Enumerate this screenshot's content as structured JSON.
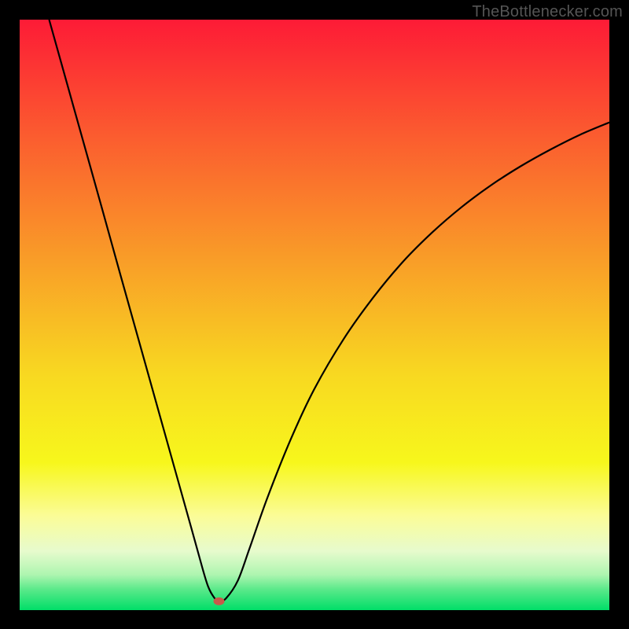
{
  "source_label": "TheBottlenecker.com",
  "chart_data": {
    "type": "line",
    "title": "",
    "xlabel": "",
    "ylabel": "",
    "xlim": [
      0,
      100
    ],
    "ylim": [
      0,
      100
    ],
    "grid": false,
    "background": {
      "type": "vertical-gradient",
      "stops": [
        {
          "offset": 0.0,
          "color": "#fd1b36"
        },
        {
          "offset": 0.2,
          "color": "#fb5d2f"
        },
        {
          "offset": 0.4,
          "color": "#f99b28"
        },
        {
          "offset": 0.6,
          "color": "#f8d821"
        },
        {
          "offset": 0.75,
          "color": "#f7f71c"
        },
        {
          "offset": 0.84,
          "color": "#fbfc97"
        },
        {
          "offset": 0.9,
          "color": "#e7fbcd"
        },
        {
          "offset": 0.94,
          "color": "#aef5b0"
        },
        {
          "offset": 0.965,
          "color": "#5ae98a"
        },
        {
          "offset": 1.0,
          "color": "#00de68"
        }
      ]
    },
    "series": [
      {
        "name": "curve",
        "color": "#000000",
        "x": [
          5,
          8,
          11,
          14,
          17,
          20,
          23,
          26,
          29,
          31,
          32,
          33,
          33.8,
          35,
          37,
          39,
          42,
          46,
          50,
          55,
          60,
          65,
          70,
          75,
          80,
          85,
          90,
          95,
          100
        ],
        "y": [
          100,
          89.3,
          78.6,
          67.9,
          57.1,
          46.4,
          35.7,
          25,
          14.3,
          7.1,
          3.9,
          2.1,
          1.5,
          2,
          5,
          10.5,
          19,
          29,
          37.5,
          46,
          53,
          59,
          64,
          68.3,
          72,
          75.2,
          78,
          80.5,
          82.6
        ]
      }
    ],
    "markers": [
      {
        "name": "optimal-point",
        "x": 33.8,
        "y": 1.5,
        "color": "#c9594a",
        "rx": 7,
        "ry": 5
      }
    ]
  }
}
